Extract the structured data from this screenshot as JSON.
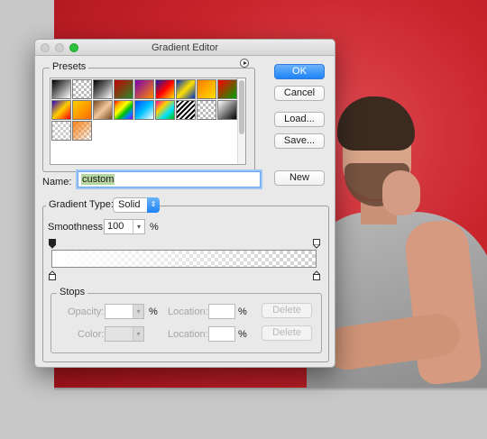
{
  "dialog": {
    "title": "Gradient Editor",
    "presets_label": "Presets",
    "buttons": {
      "ok": "OK",
      "cancel": "Cancel",
      "load": "Load...",
      "save": "Save...",
      "new": "New"
    },
    "name_label": "Name:",
    "name_value": "custom",
    "gradient_type_label": "Gradient Type:",
    "gradient_type_value": "Solid",
    "smoothness_label": "Smoothness:",
    "smoothness_value": "100",
    "smoothness_unit": "%",
    "stops": {
      "group_label": "Stops",
      "opacity_label": "Opacity:",
      "opacity_unit": "%",
      "color_label": "Color:",
      "location_label": "Location:",
      "location_unit": "%",
      "delete_label": "Delete"
    }
  },
  "colors": {
    "accent": "#1e82f5",
    "traffic_zoom": "#2bc33e",
    "canvas_red": "#c8242c"
  },
  "icons": {
    "presets_menu": "circle-arrow-right-icon",
    "select_arrow": "updown-chevron-icon",
    "combo_arrow": "chevron-down-icon"
  }
}
